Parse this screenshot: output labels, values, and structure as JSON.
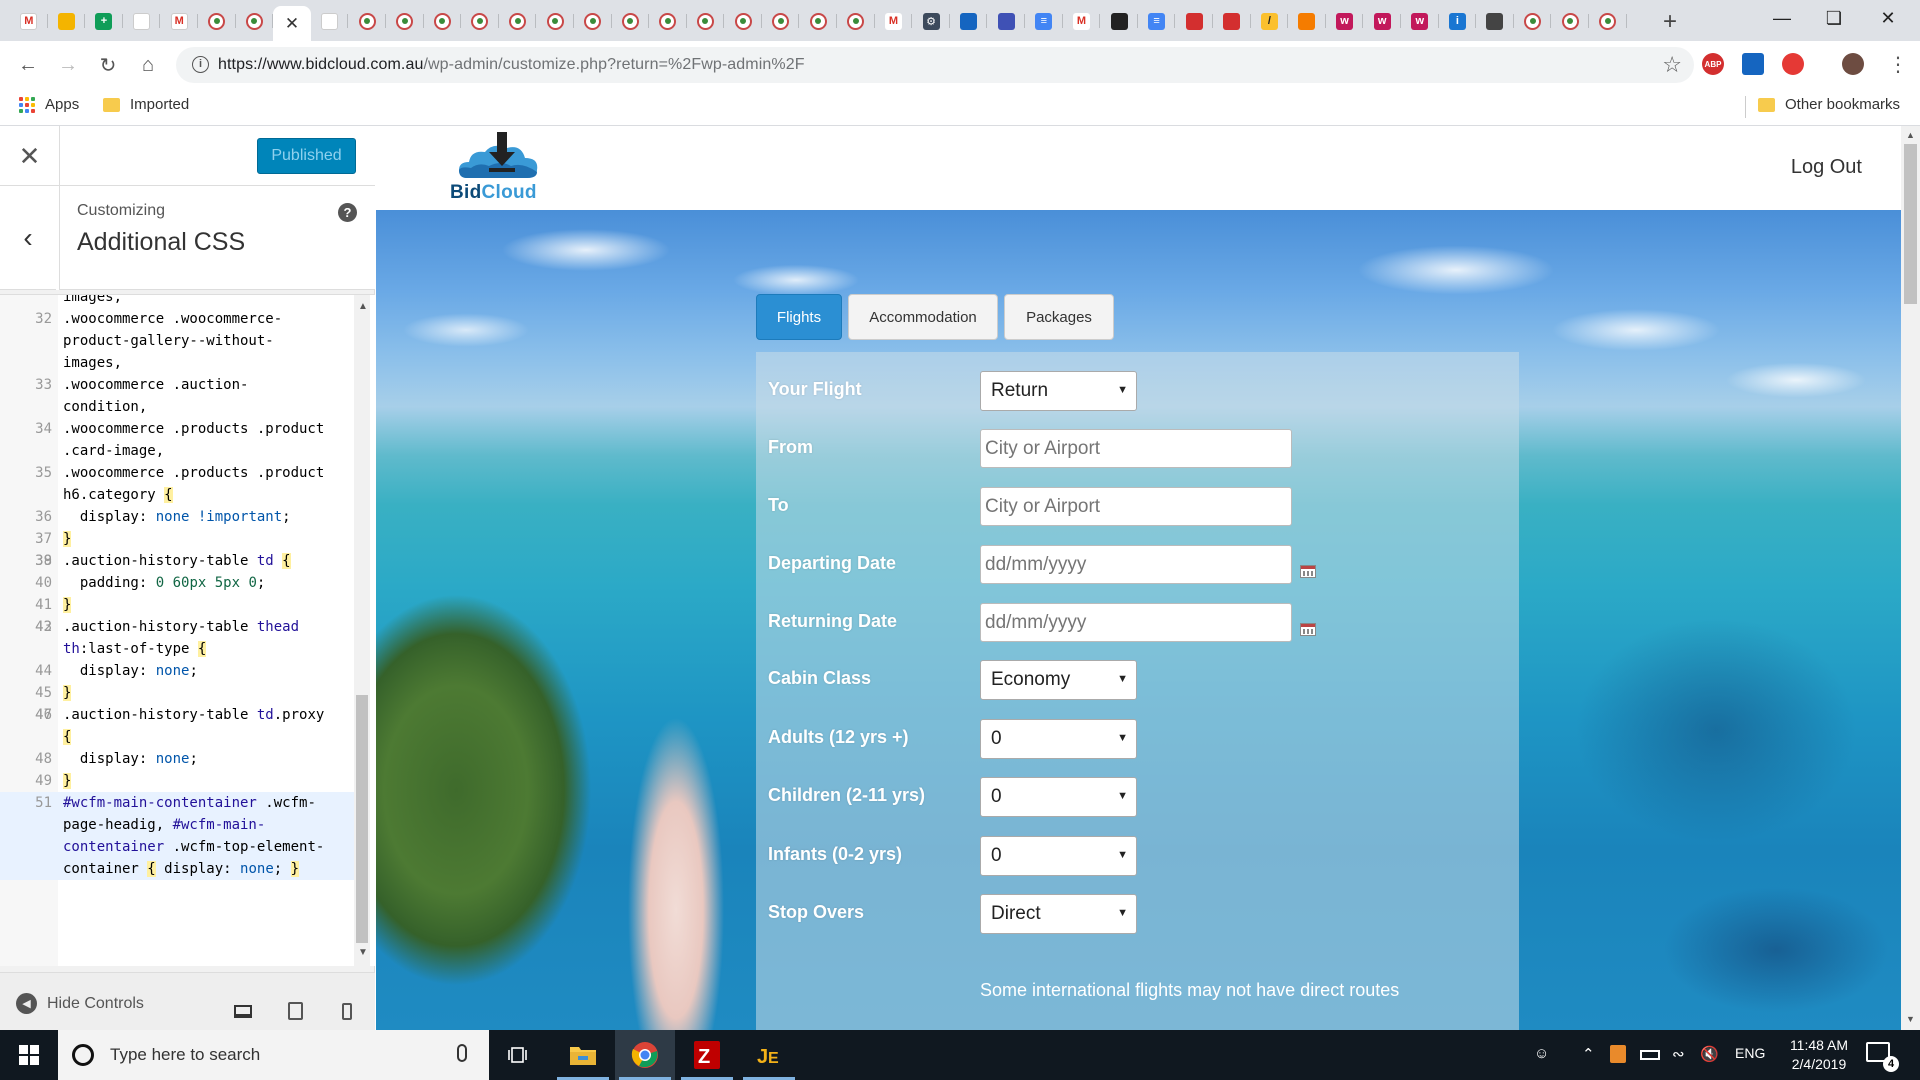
{
  "browser": {
    "url_host": "https://www.bidcloud.com.au",
    "url_path": "/wp-admin/customize.php?return=%2Fwp-admin%2F",
    "bookmarks": {
      "apps": "Apps",
      "imported": "Imported",
      "other": "Other bookmarks"
    },
    "extensions": {
      "abp": "ABP"
    }
  },
  "customizer": {
    "published_label": "Published",
    "customizing_label": "Customizing",
    "section_title": "Additional CSS",
    "help_label": "?",
    "hide_controls_label": "Hide Controls",
    "code_lines": [
      {
        "n": "",
        "text": "images,"
      },
      {
        "n": "32",
        "text": ".woocommerce .woocommerce-"
      },
      {
        "n": "",
        "text": "product-gallery--without-"
      },
      {
        "n": "",
        "text": "images,"
      },
      {
        "n": "33",
        "text": ".woocommerce .auction-"
      },
      {
        "n": "",
        "text": "condition,"
      },
      {
        "n": "34",
        "text": ".woocommerce .products .product"
      },
      {
        "n": "",
        "text": ".card-image,"
      },
      {
        "n": "35",
        "text": ".woocommerce .products .product"
      },
      {
        "n": "",
        "text": "h6.category {"
      },
      {
        "n": "36",
        "text": "  display: none !important;"
      },
      {
        "n": "37",
        "text": "}"
      },
      {
        "n": "38",
        "text": ""
      },
      {
        "n": "39",
        "text": ".auction-history-table td {"
      },
      {
        "n": "40",
        "text": "  padding: 0 60px 5px 0;"
      },
      {
        "n": "41",
        "text": "}"
      },
      {
        "n": "42",
        "text": ""
      },
      {
        "n": "43",
        "text": ".auction-history-table thead"
      },
      {
        "n": "",
        "text": "th:last-of-type {"
      },
      {
        "n": "44",
        "text": "  display: none;"
      },
      {
        "n": "45",
        "text": "}"
      },
      {
        "n": "46",
        "text": ""
      },
      {
        "n": "47",
        "text": ".auction-history-table td.proxy"
      },
      {
        "n": "",
        "text": "{"
      },
      {
        "n": "48",
        "text": "  display: none;"
      },
      {
        "n": "49",
        "text": "}"
      },
      {
        "n": "50",
        "text": ""
      },
      {
        "n": "51",
        "text": "#wcfm-main-contentainer .wcfm-",
        "hl": true
      },
      {
        "n": "",
        "text": "page-headig, #wcfm-main-",
        "hl": true
      },
      {
        "n": "",
        "text": "contentainer .wcfm-top-element-",
        "hl": true
      },
      {
        "n": "",
        "text": "container { display: none; }",
        "hl": true
      }
    ]
  },
  "site": {
    "logo_text_1": "Bid",
    "logo_text_2": "Cloud",
    "logout_label": "Log Out",
    "tabs": {
      "flights": "Flights",
      "accommodation": "Accommodation",
      "packages": "Packages"
    },
    "form": {
      "your_flight_label": "Your Flight",
      "your_flight_value": "Return",
      "from_label": "From",
      "from_placeholder": "City or Airport",
      "to_label": "To",
      "to_placeholder": "City or Airport",
      "departing_label": "Departing Date",
      "departing_placeholder": "dd/mm/yyyy",
      "returning_label": "Returning Date",
      "returning_placeholder": "dd/mm/yyyy",
      "cabin_label": "Cabin Class",
      "cabin_value": "Economy",
      "adults_label": "Adults (12 yrs +)",
      "adults_value": "0",
      "children_label": "Children (2-11 yrs)",
      "children_value": "0",
      "infants_label": "Infants (0-2 yrs)",
      "infants_value": "0",
      "stopovers_label": "Stop Overs",
      "stopovers_value": "Direct",
      "note": "Some international flights may not have direct routes"
    }
  },
  "taskbar": {
    "search_placeholder": "Type here to search",
    "language": "ENG",
    "time": "11:48 AM",
    "date": "2/4/2019",
    "notification_count": "4"
  },
  "colors": {
    "accent": "#0085ba",
    "flights_tab": "#2b8fd3",
    "taskbar": "#101820"
  }
}
